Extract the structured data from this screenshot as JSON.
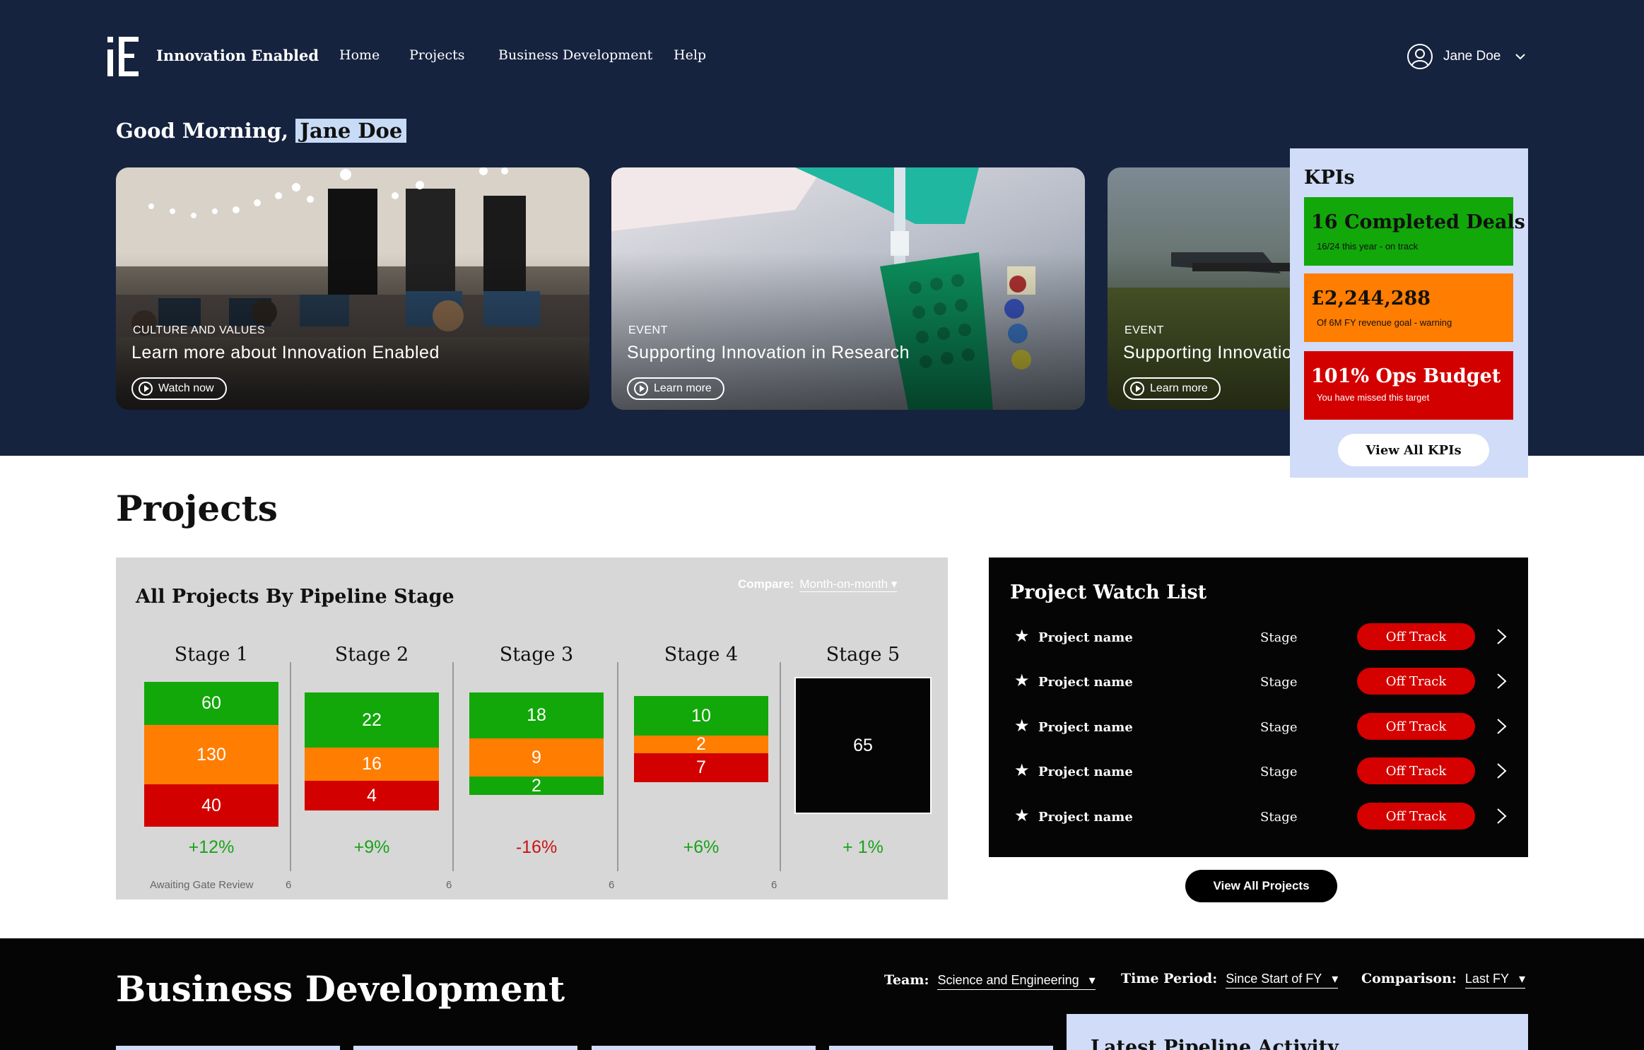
{
  "brand": {
    "name": "Innovation Enabled"
  },
  "nav": {
    "items": [
      "Home",
      "Projects",
      "Business Development",
      "Help"
    ]
  },
  "user": {
    "name": "Jane Doe"
  },
  "greeting": {
    "prefix": "Good Morning,",
    "name": "Jane Doe"
  },
  "cards": [
    {
      "category": "CULTURE AND VALUES",
      "title": "Learn more about Innovation Enabled",
      "button": "Watch now"
    },
    {
      "category": "EVENT",
      "title": "Supporting Innovation in Research",
      "button": "Learn more"
    },
    {
      "category": "EVENT",
      "title": "Supporting Innovation in Research",
      "button": "Learn more"
    }
  ],
  "kpis": {
    "title": "KPIs",
    "items": [
      {
        "value": "16 Completed Deals",
        "sub": "16/24 this year - on track",
        "color": "#12a80a"
      },
      {
        "value": "£2,244,288",
        "sub": "Of 6M FY revenue goal - warning",
        "color": "#ff7d00"
      },
      {
        "value": "101% Ops Budget",
        "sub": "You have missed this target",
        "color": "#d30000"
      }
    ],
    "button": "View All KPIs"
  },
  "projects": {
    "title": "Projects",
    "pipeline": {
      "title": "All Projects By Pipeline Stage",
      "compare_label": "Compare:",
      "compare_value": "Month-on-month",
      "footer_label": "Awaiting Gate Review",
      "footer_values": [
        "6",
        "6",
        "6",
        "6"
      ],
      "stages": [
        {
          "name": "Stage 1",
          "change": "+12%",
          "change_color": "#1aa21a",
          "segments": [
            {
              "value": "60",
              "color": "#12a80a"
            },
            {
              "value": "130",
              "color": "#ff7d00"
            },
            {
              "value": "40",
              "color": "#d30000"
            }
          ]
        },
        {
          "name": "Stage 2",
          "change": "+9%",
          "change_color": "#1aa21a",
          "segments": [
            {
              "value": "22",
              "color": "#12a80a"
            },
            {
              "value": "16",
              "color": "#ff7d00"
            },
            {
              "value": "4",
              "color": "#d30000"
            }
          ]
        },
        {
          "name": "Stage 3",
          "change": "-16%",
          "change_color": "#c81414",
          "segments": [
            {
              "value": "18",
              "color": "#12a80a"
            },
            {
              "value": "9",
              "color": "#ff7d00"
            },
            {
              "value": "2",
              "color": "#12a80a"
            }
          ]
        },
        {
          "name": "Stage 4",
          "change": "+6%",
          "change_color": "#1aa21a",
          "segments": [
            {
              "value": "10",
              "color": "#12a80a"
            },
            {
              "value": "2",
              "color": "#ff7d00"
            },
            {
              "value": "7",
              "color": "#d30000"
            }
          ]
        },
        {
          "name": "Stage 5",
          "change": "+ 1%",
          "change_color": "#1aa21a",
          "segments": [
            {
              "value": "65",
              "color": "#050505"
            }
          ]
        }
      ]
    },
    "watch": {
      "title": "Project Watch List",
      "rows": [
        {
          "name": "Project name",
          "stage": "Stage",
          "status": "Off Track"
        },
        {
          "name": "Project name",
          "stage": "Stage",
          "status": "Off Track"
        },
        {
          "name": "Project name",
          "stage": "Stage",
          "status": "Off Track"
        },
        {
          "name": "Project name",
          "stage": "Stage",
          "status": "Off Track"
        },
        {
          "name": "Project name",
          "stage": "Stage",
          "status": "Off Track"
        }
      ]
    },
    "view_all": "View All Projects"
  },
  "bizdev": {
    "title": "Business Development",
    "filters": [
      {
        "label": "Team:",
        "value": "Science and Engineering"
      },
      {
        "label": "Time Period:",
        "value": "Since Start of FY"
      },
      {
        "label": "Comparison:",
        "value": "Last FY"
      }
    ],
    "latest_title": "Latest Pipeline Activity"
  }
}
